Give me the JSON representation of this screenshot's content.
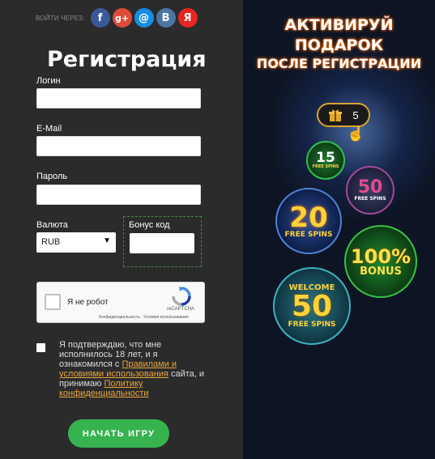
{
  "social": {
    "label": "ВОЙТИ ЧЕРЕЗ:",
    "icons": [
      {
        "name": "facebook",
        "glyph": "f",
        "color": "#3b5998"
      },
      {
        "name": "google-plus",
        "glyph": "g+",
        "color": "#dd4b39"
      },
      {
        "name": "mail-ru",
        "glyph": "@",
        "color": "#168de2"
      },
      {
        "name": "vkontakte",
        "glyph": "B",
        "color": "#4c75a3"
      },
      {
        "name": "yandex",
        "glyph": "Я",
        "color": "#e52620"
      }
    ]
  },
  "form": {
    "title": "Регистрация",
    "login_label": "Логин",
    "email_label": "E-Mail",
    "password_label": "Пароль",
    "currency_label": "Валюта",
    "currency_value": "RUB",
    "bonus_label": "Бонус код",
    "captcha": {
      "text": "Я не робот",
      "brand": "reCAPTCHA",
      "links": "Конфиденциальность - Условия использования"
    },
    "agree_text_1": "Я подтверждаю, что мне исполнилось 18 лет, и я ознакомился с ",
    "agree_link_1": "Правилами и условиями использования",
    "agree_text_2": " сайта, и принимаю ",
    "agree_link_2": "Политику конфиденциальности",
    "start_button": "НАЧАТЬ ИГРУ"
  },
  "promo": {
    "line1": "АКТИВИРУЙ",
    "line2": "ПОДАРОК",
    "line3": "ПОСЛЕ РЕГИСТРАЦИИ",
    "gift_count": "5",
    "coins": [
      {
        "big": "15",
        "small": "FREE SPINS"
      },
      {
        "big": "50",
        "small": "FREE SPINS"
      },
      {
        "big": "20",
        "small": "FREE SPINS"
      },
      {
        "big": "100%",
        "small": "BONUS"
      },
      {
        "top": "WELCOME",
        "big": "50",
        "small": "FREE SPINS"
      }
    ]
  }
}
